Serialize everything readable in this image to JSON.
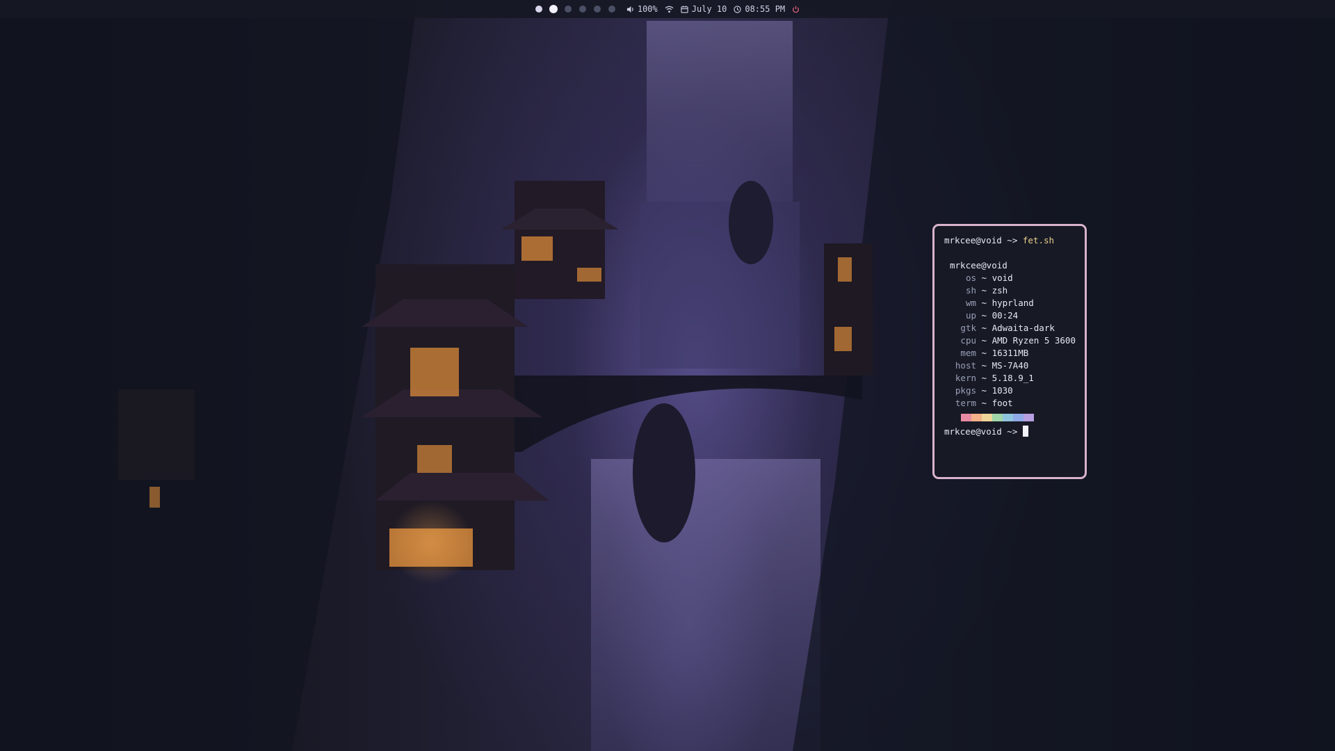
{
  "topbar": {
    "workspaces": [
      {
        "state": "occupied"
      },
      {
        "state": "active"
      },
      {
        "state": "empty"
      },
      {
        "state": "empty"
      },
      {
        "state": "empty"
      },
      {
        "state": "empty"
      }
    ],
    "volume": {
      "icon": "speaker-icon",
      "value": "100%"
    },
    "network": {
      "icon": "wifi-icon"
    },
    "date": {
      "icon": "calendar-icon",
      "value": "July 10"
    },
    "time": {
      "icon": "clock-icon",
      "value": "08:55 PM"
    },
    "power": {
      "icon": "power-icon",
      "color": "#e0607a"
    }
  },
  "terminal": {
    "prompt": "mrkcee@void ~>",
    "command": "fet.sh",
    "header": "mrkcee@void",
    "info": [
      {
        "key": "os",
        "value": "void"
      },
      {
        "key": "sh",
        "value": "zsh"
      },
      {
        "key": "wm",
        "value": "hyprland"
      },
      {
        "key": "up",
        "value": "00:24"
      },
      {
        "key": "gtk",
        "value": "Adwaita-dark"
      },
      {
        "key": "cpu",
        "value": "AMD Ryzen 5 3600"
      },
      {
        "key": "mem",
        "value": "16311MB"
      },
      {
        "key": "host",
        "value": "MS-7A40"
      },
      {
        "key": "kern",
        "value": "5.18.9_1"
      },
      {
        "key": "pkgs",
        "value": "1030"
      },
      {
        "key": "term",
        "value": "foot"
      }
    ],
    "separator": "~",
    "palette": [
      "#e88aa3",
      "#f4b088",
      "#f0d598",
      "#9fd5a8",
      "#8fc4de",
      "#8fa8e8",
      "#b79fe2"
    ],
    "border_color": "#d9b3cc"
  }
}
